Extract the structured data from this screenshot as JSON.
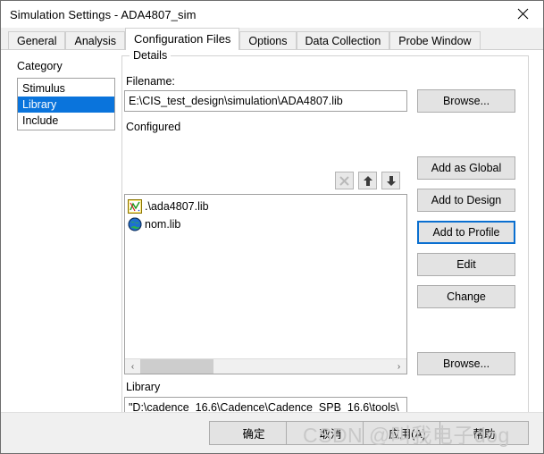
{
  "window": {
    "title": "Simulation Settings - ADA4807_sim",
    "close_icon": "close-icon"
  },
  "tabs": [
    {
      "label": "General",
      "active": false
    },
    {
      "label": "Analysis",
      "active": false
    },
    {
      "label": "Configuration Files",
      "active": true
    },
    {
      "label": "Options",
      "active": false
    },
    {
      "label": "Data Collection",
      "active": false
    },
    {
      "label": "Probe Window",
      "active": false
    }
  ],
  "category": {
    "label": "Category",
    "items": [
      {
        "label": "Stimulus",
        "selected": false
      },
      {
        "label": "Library",
        "selected": true
      },
      {
        "label": "Include",
        "selected": false
      }
    ]
  },
  "details": {
    "group_title": "Details",
    "filename_label": "Filename:",
    "filename_value": "E:\\CIS_test_design\\simulation\\ADA4807.lib",
    "configured_label": "Configured",
    "toolbar": [
      {
        "name": "delete-icon",
        "glyph": "✕",
        "enabled": false
      },
      {
        "name": "move-up-icon",
        "glyph": "↑",
        "enabled": true
      },
      {
        "name": "move-down-icon",
        "glyph": "↓",
        "enabled": true
      }
    ],
    "configured_items": [
      {
        "label": ".\\ada4807.lib",
        "icon": "design-library-icon"
      },
      {
        "label": "nom.lib",
        "icon": "global-library-icon"
      }
    ],
    "library_label": "Library",
    "library_value": "\"D:\\cadence_16.6\\Cadence\\Cadence_SPB_16.6\\tools\\",
    "scroll_left_icon": "‹",
    "scroll_right_icon": "›"
  },
  "side_buttons": {
    "browse_top": "Browse...",
    "add_as_global": "Add as Global",
    "add_to_design": "Add to Design",
    "add_to_profile": "Add to Profile",
    "edit": "Edit",
    "change": "Change",
    "browse_bottom": "Browse..."
  },
  "dialog_buttons": [
    {
      "label": "确定"
    },
    {
      "label": "取消"
    },
    {
      "label": "应用(A)"
    },
    {
      "label": "帮助"
    }
  ],
  "watermark": "CSDN @叫我电子dog",
  "colors": {
    "selection_blue": "#0a74dc",
    "focus_blue": "#0a6fd0",
    "dialog_face": "#f0f0f0",
    "button_face": "#e3e3e3"
  }
}
